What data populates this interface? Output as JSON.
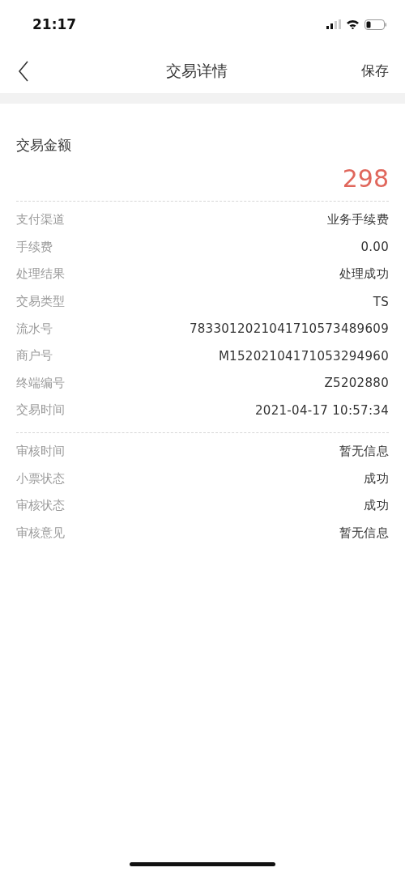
{
  "status_bar": {
    "time": "21:17"
  },
  "nav_bar": {
    "title": "交易详情",
    "action": "保存"
  },
  "amount": {
    "label": "交易金额",
    "value": "298"
  },
  "sections": [
    {
      "rows": [
        {
          "label": "支付渠道",
          "value": "业务手续费"
        },
        {
          "label": "手续费",
          "value": "0.00"
        },
        {
          "label": "处理结果",
          "value": "处理成功"
        },
        {
          "label": "交易类型",
          "value": "TS"
        },
        {
          "label": "流水号",
          "value": "7833012021041710573489609"
        },
        {
          "label": "商户号",
          "value": "M15202104171053294960"
        },
        {
          "label": "终端编号",
          "value": "Z5202880"
        },
        {
          "label": "交易时间",
          "value": "2021-04-17 10:57:34"
        }
      ]
    },
    {
      "rows": [
        {
          "label": "审核时间",
          "value": "暂无信息"
        },
        {
          "label": "小票状态",
          "value": "成功"
        },
        {
          "label": "审核状态",
          "value": "成功"
        },
        {
          "label": "审核意见",
          "value": "暂无信息"
        }
      ]
    }
  ]
}
